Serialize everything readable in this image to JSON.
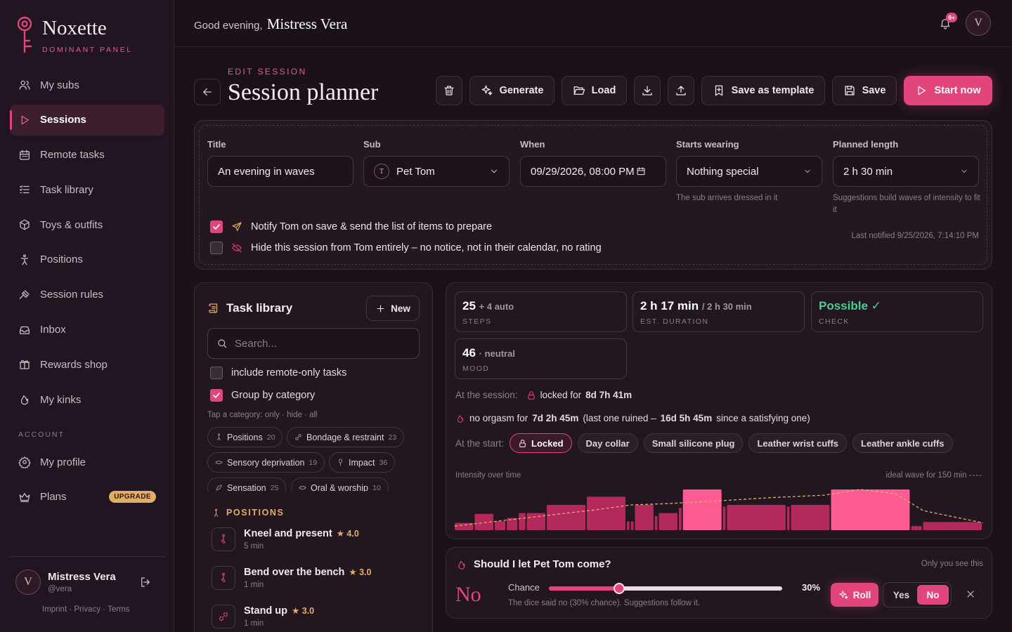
{
  "brand": {
    "name": "Noxette",
    "subtitle": "DOMINANT PANEL",
    "accent": "#e2457c"
  },
  "nav": {
    "items": [
      {
        "label": "My subs",
        "icon": "users-icon"
      },
      {
        "label": "Sessions",
        "icon": "play-icon",
        "active": true
      },
      {
        "label": "Remote tasks",
        "icon": "calendar-icon"
      },
      {
        "label": "Task library",
        "icon": "list-icon"
      },
      {
        "label": "Toys & outfits",
        "icon": "box-icon"
      },
      {
        "label": "Positions",
        "icon": "figure-icon"
      },
      {
        "label": "Session rules",
        "icon": "gavel-icon"
      },
      {
        "label": "Inbox",
        "icon": "inbox-icon"
      },
      {
        "label": "Rewards shop",
        "icon": "gift-icon"
      },
      {
        "label": "My kinks",
        "icon": "flame-icon"
      }
    ],
    "account_label": "ACCOUNT",
    "account_items": [
      {
        "label": "My profile",
        "icon": "gear-icon"
      },
      {
        "label": "Plans",
        "icon": "crown-icon",
        "badge": "UPGRADE"
      }
    ]
  },
  "user": {
    "initial": "V",
    "name": "Mistress Vera",
    "handle": "@vera"
  },
  "legal": "Imprint · Privacy · Terms",
  "header": {
    "greeting": "Good evening,",
    "name": "Mistress Vera",
    "notif_badge": "9+",
    "avatar_initial": "V"
  },
  "page": {
    "eyebrow": "EDIT SESSION",
    "title": "Session planner"
  },
  "toolbar": {
    "generate": "Generate",
    "load": "Load",
    "save_template": "Save as template",
    "save": "Save",
    "start": "Start now"
  },
  "form": {
    "title_label": "Title",
    "title_value": "An evening in waves",
    "sub_label": "Sub",
    "sub_initial": "T",
    "sub_value": "Pet Tom",
    "when_label": "When",
    "when_value": "09/29/2026, 08:00 PM",
    "wearing_label": "Starts wearing",
    "wearing_value": "Nothing special",
    "wearing_hint": "The sub arrives dressed in it",
    "length_label": "Planned length",
    "length_value": "2 h 30 min",
    "length_hint": "Suggestions build waves of intensity to fit it",
    "notify_text": "Notify Tom on save & send the list of items to prepare",
    "notify_checked": true,
    "hide_text": "Hide this session from Tom entirely – no notice, not in their calendar, no rating",
    "hide_checked": false,
    "last_notified": "Last notified 9/25/2026, 7:14:10 PM"
  },
  "library": {
    "title": "Task library",
    "new_label": "New",
    "search_placeholder": "Search...",
    "remote_only_label": "include remote-only tasks",
    "remote_only_checked": false,
    "group_label": "Group by category",
    "group_checked": true,
    "tap_hint": "Tap a category: only · hide · all",
    "chips": [
      {
        "label": "Positions",
        "count": "20"
      },
      {
        "label": "Bondage & restraint",
        "count": "23"
      },
      {
        "label": "Sensory deprivation",
        "count": "19"
      },
      {
        "label": "Impact",
        "count": "36"
      },
      {
        "label": "Sensation",
        "count": "25"
      },
      {
        "label": "Oral & worship",
        "count": "10"
      }
    ],
    "section": "POSITIONS",
    "tasks": [
      {
        "name": "Kneel and present",
        "rating": "4.0",
        "meta": "5 min"
      },
      {
        "name": "Bend over the bench",
        "rating": "3.0",
        "meta": "1 min"
      },
      {
        "name": "Stand up",
        "rating": "3.0",
        "meta": "1 min"
      }
    ]
  },
  "stats": {
    "steps_main": "25",
    "steps_extra": "+ 4 auto",
    "steps_label": "STEPS",
    "dur_main": "2 h 17 min",
    "dur_extra": "/ 2 h 30 min",
    "dur_label": "EST. DURATION",
    "check_main": "Possible ✓",
    "check_label": "CHECK",
    "check_color": "#4ccf8c",
    "mood_main": "46",
    "mood_extra": "· neutral",
    "mood_label": "MOOD",
    "at_session_label": "At the session:",
    "locked_text": "locked for",
    "locked_value": "8d 7h 41m",
    "orgasm_prefix": "no orgasm for",
    "orgasm_value": "7d 2h 45m",
    "orgasm_mid": "(last one ruined –",
    "orgasm_value2": "16d 5h 45m",
    "orgasm_suffix": "since a satisfying one)",
    "at_start_label": "At the start:",
    "start_items": [
      "Locked",
      "Day collar",
      "Small silicone plug",
      "Leather wrist cuffs",
      "Leather ankle cuffs"
    ],
    "intensity_label": "Intensity over time",
    "ideal_label": "ideal wave for 150 min"
  },
  "chart_data": {
    "type": "bar",
    "title": "Intensity over time",
    "series_note": "bars = planned steps (relative intensity 0–1, duration in min); dashed line = ideal wave for 150 min",
    "steps": [
      {
        "dur": 5,
        "v": 0.18
      },
      {
        "dur": 5,
        "v": 0.4
      },
      {
        "dur": 3,
        "v": 0.22
      },
      {
        "dur": 3,
        "v": 0.3
      },
      {
        "dur": 2,
        "v": 0.42
      },
      {
        "dur": 5,
        "v": 0.42
      },
      {
        "dur": 10,
        "v": 0.62
      },
      {
        "dur": 10,
        "v": 0.82
      },
      {
        "dur": 1,
        "v": 0.22
      },
      {
        "dur": 1,
        "v": 0.22
      },
      {
        "dur": 5,
        "v": 0.62
      },
      {
        "dur": 1,
        "v": 0.35
      },
      {
        "dur": 5,
        "v": 0.42
      },
      {
        "dur": 1,
        "v": 0.55
      },
      {
        "dur": 10,
        "v": 1.0
      },
      {
        "dur": 1,
        "v": 0.58
      },
      {
        "dur": 15,
        "v": 0.62
      },
      {
        "dur": 1,
        "v": 0.58
      },
      {
        "dur": 10,
        "v": 0.62
      },
      {
        "dur": 20,
        "v": 1.0
      },
      {
        "dur": 3,
        "v": 0.1
      },
      {
        "dur": 15,
        "v": 0.2
      }
    ],
    "total_min": 150,
    "ideal": [
      [
        0,
        0.1
      ],
      [
        20,
        0.3
      ],
      [
        40,
        0.5
      ],
      [
        50,
        0.62
      ],
      [
        60,
        0.65
      ],
      [
        75,
        0.72
      ],
      [
        90,
        0.8
      ],
      [
        105,
        0.86
      ],
      [
        115,
        1.0
      ],
      [
        125,
        0.9
      ],
      [
        133,
        0.48
      ],
      [
        150,
        0.18
      ]
    ],
    "highlight_color": "#ff5c93",
    "bar_color": "#b4295b"
  },
  "come": {
    "title": "Should I let Pet Tom come?",
    "only_you": "Only you see this",
    "answer": "No",
    "chance_label": "Chance",
    "chance_value": "30%",
    "chance": 0.3,
    "dice_text": "The dice said no (30% chance). Suggestions follow it.",
    "roll": "Roll",
    "yes": "Yes",
    "no": "No",
    "selected": "No"
  }
}
